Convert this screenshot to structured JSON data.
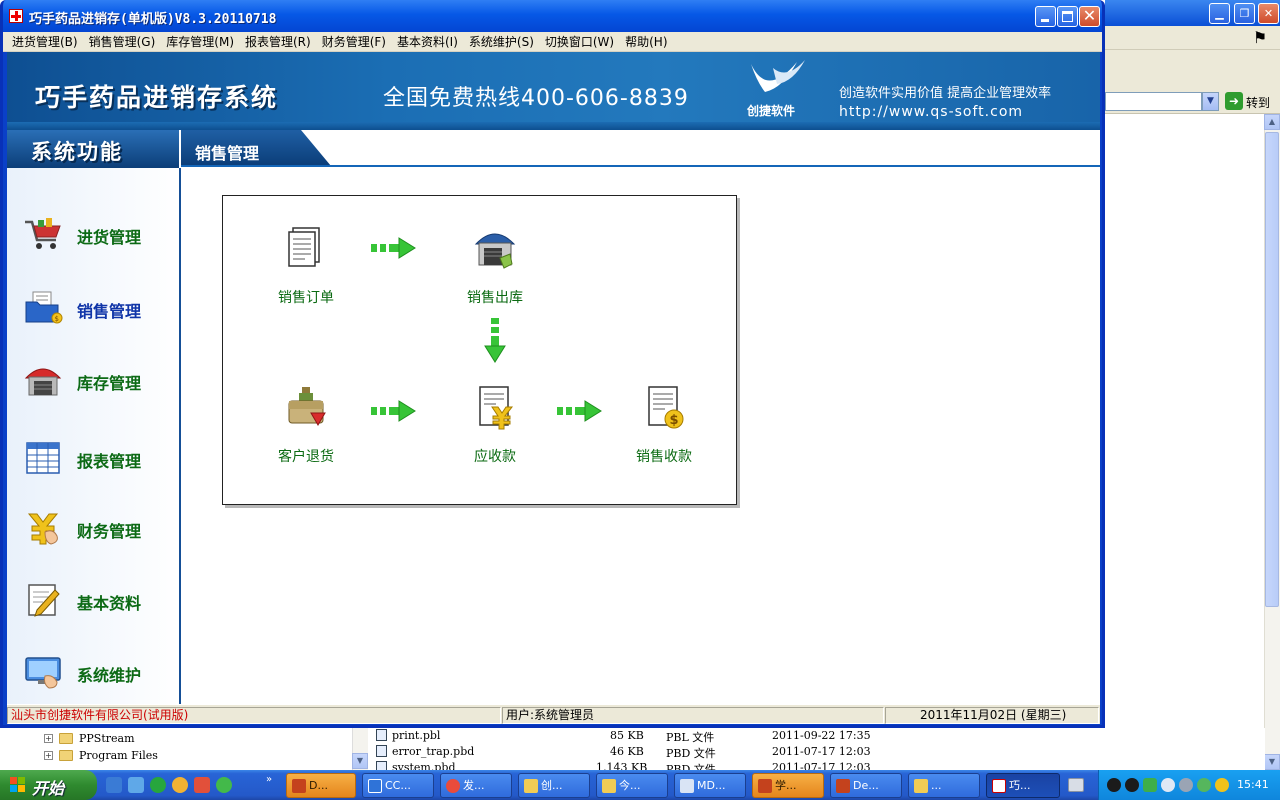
{
  "window": {
    "title": "巧手药品进销存(单机版)V8.3.20110718"
  },
  "menubar": {
    "items": [
      "进货管理(B)",
      "销售管理(G)",
      "库存管理(M)",
      "报表管理(R)",
      "财务管理(F)",
      "基本资料(I)",
      "系统维护(S)",
      "切换窗口(W)",
      "帮助(H)"
    ]
  },
  "banner": {
    "title": "巧手药品进销存系统",
    "hotline": "全国免费热线400-606-8839",
    "brand_name": "创捷软件",
    "slogan": "创造软件实用价值  提高企业管理效率",
    "url": "http://www.qs-soft.com"
  },
  "header": {
    "left_title": "系统功能",
    "section_title": "销售管理"
  },
  "sidebar": {
    "items": [
      {
        "label": "进货管理",
        "icon": "shopping-cart-icon"
      },
      {
        "label": "销售管理",
        "icon": "sales-folder-icon",
        "active": true
      },
      {
        "label": "库存管理",
        "icon": "warehouse-icon"
      },
      {
        "label": "报表管理",
        "icon": "report-table-icon"
      },
      {
        "label": "财务管理",
        "icon": "finance-icon"
      },
      {
        "label": "基本资料",
        "icon": "edit-document-icon"
      },
      {
        "label": "系统维护",
        "icon": "monitor-icon"
      }
    ]
  },
  "flow": {
    "nodes": [
      {
        "id": "sales-order",
        "label": "销售订单",
        "icon": "document-icon"
      },
      {
        "id": "sales-outbound",
        "label": "销售出库",
        "icon": "warehouse-icon"
      },
      {
        "id": "customer-return",
        "label": "客户退货",
        "icon": "return-bag-icon"
      },
      {
        "id": "receivable",
        "label": "应收款",
        "icon": "yuan-document-icon"
      },
      {
        "id": "sales-collection",
        "label": "销售收款",
        "icon": "dollar-document-icon"
      }
    ]
  },
  "statusbar": {
    "company": "汕头市创捷软件有限公司(试用版)",
    "user": "用户:系统管理员",
    "date": "2011年11月02日 (星期三)"
  },
  "background_window": {
    "go_label": "转到",
    "tree": [
      "PPStream",
      "Program Files"
    ],
    "files": [
      {
        "name": "print.pbl",
        "size": "85 KB",
        "type": "PBL 文件",
        "modified": "2011-09-22 17:35"
      },
      {
        "name": "error_trap.pbd",
        "size": "46 KB",
        "type": "PBD 文件",
        "modified": "2011-07-17 12:03"
      },
      {
        "name": "system.pbd",
        "size": "1,143 KB",
        "type": "PBD 文件",
        "modified": "2011-07-17 12:03"
      }
    ]
  },
  "taskbar": {
    "start_label": "开始",
    "quicklaunch_more": "»",
    "buttons": [
      {
        "label": "D...",
        "style": "orange"
      },
      {
        "label": "CC...",
        "style": "blue"
      },
      {
        "label": "发...",
        "style": "blue"
      },
      {
        "label": "创...",
        "style": "blue"
      },
      {
        "label": "今...",
        "style": "blue"
      },
      {
        "label": "MD...",
        "style": "blue"
      },
      {
        "label": "学...",
        "style": "orange"
      },
      {
        "label": "De...",
        "style": "blue"
      },
      {
        "label": "...",
        "style": "blue"
      },
      {
        "label": "巧...",
        "style": "active"
      }
    ],
    "clock": "15:41"
  },
  "colors": {
    "title_blue": "#0658e6",
    "sidebar_label_green": "#0c6a15",
    "sidebar_active_blue": "#1035a8",
    "status_company_red": "#cc0000",
    "flow_arrow_green": "#37c437"
  }
}
